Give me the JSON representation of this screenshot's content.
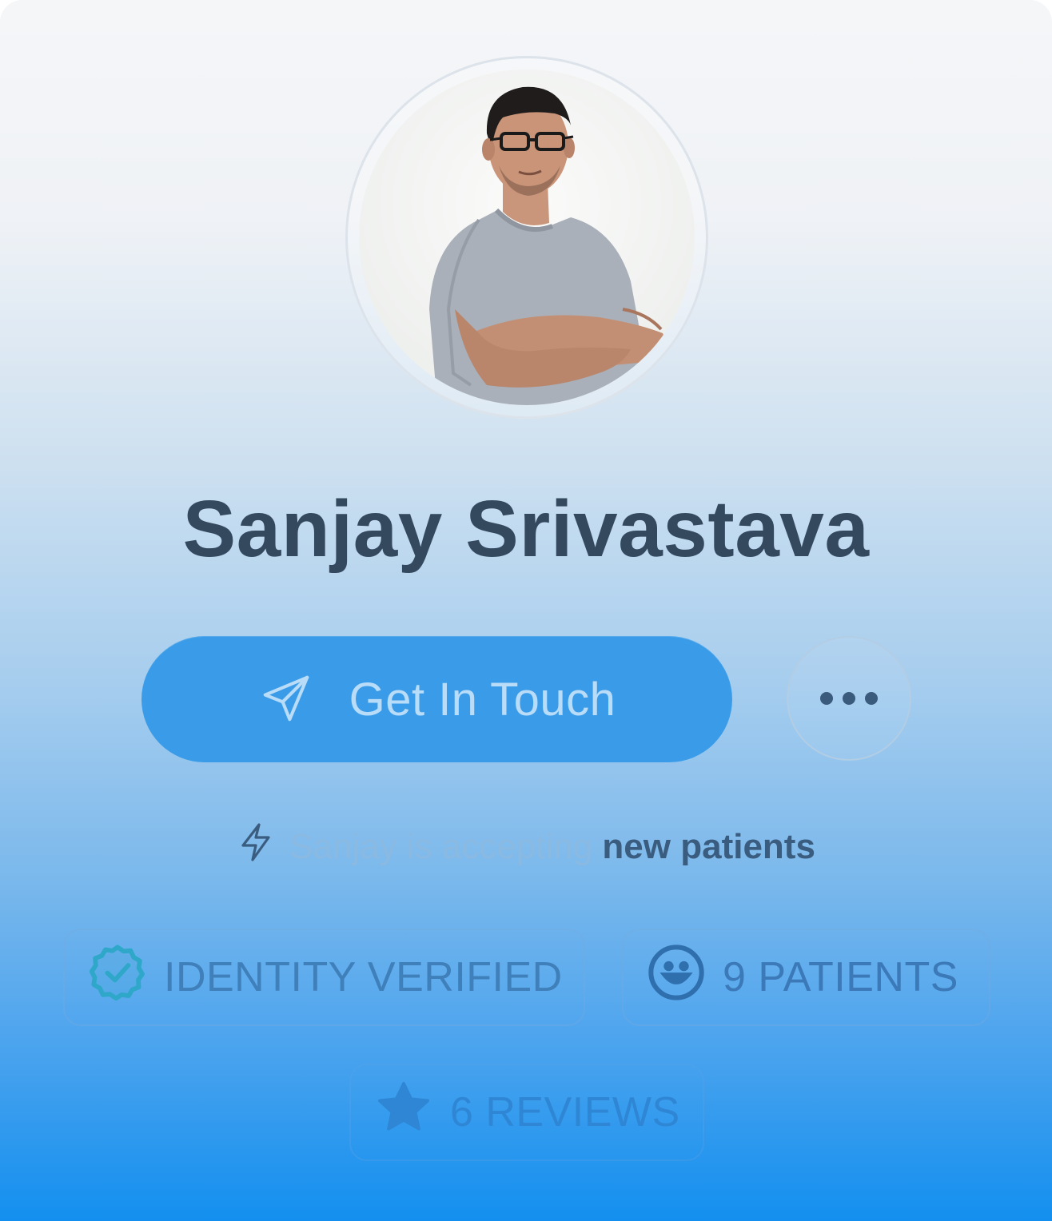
{
  "profile": {
    "name": "Sanjay Srivastava",
    "avatar_alt": "Sanjay Srivastava"
  },
  "actions": {
    "primary_label": "Get In Touch",
    "primary_icon": "paper-plane-icon",
    "more_icon": "ellipsis-icon"
  },
  "status": {
    "icon": "lightning-icon",
    "prefix": "Sanjay is accepting",
    "highlight": "new patients"
  },
  "badges": [
    {
      "icon": "verified-badge-icon",
      "label": "IDENTITY VERIFIED"
    },
    {
      "icon": "smiley-icon",
      "label": "9 PATIENTS"
    },
    {
      "icon": "star-icon",
      "label": "6 REVIEWS"
    }
  ],
  "colors": {
    "name": "#34495e",
    "primary_button": "#3a9ce8",
    "primary_label": "#b9dcf8",
    "status_muted": "#8ab9e2",
    "status_strong": "#3a5c7e",
    "gradient_top": "#f5f6f8",
    "gradient_bottom": "#138fef"
  }
}
